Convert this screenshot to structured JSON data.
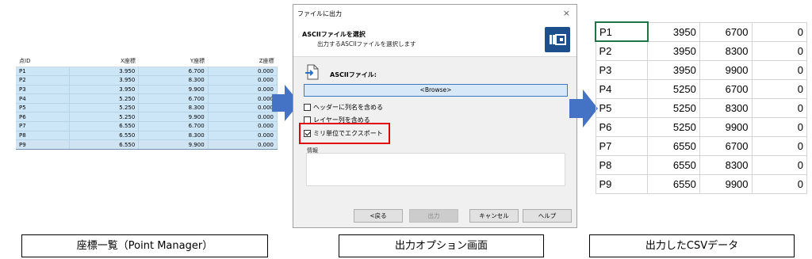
{
  "point_manager": {
    "headers": [
      "点ID",
      "X座標",
      "Y座標",
      "Z座標"
    ],
    "rows": [
      [
        "P1",
        "3.950",
        "6.700",
        "0.000"
      ],
      [
        "P2",
        "3.950",
        "8.300",
        "0.000"
      ],
      [
        "P3",
        "3.950",
        "9.900",
        "0.000"
      ],
      [
        "P4",
        "5.250",
        "6.700",
        "0.000"
      ],
      [
        "P5",
        "5.250",
        "8.300",
        "0.000"
      ],
      [
        "P6",
        "5.250",
        "9.900",
        "0.000"
      ],
      [
        "P7",
        "6.550",
        "6.700",
        "0.000"
      ],
      [
        "P8",
        "6.550",
        "8.300",
        "0.000"
      ],
      [
        "P9",
        "6.550",
        "9.900",
        "0.000"
      ]
    ]
  },
  "dialog": {
    "title": "ファイルに出力",
    "close_glyph": "×",
    "header_title": "ASCIIファイルを選択",
    "header_subtitle": "出力するASCIIファイルを選択します",
    "ascii_label": "ASCIIファイル:",
    "browse_label": "<Browse>",
    "options": [
      {
        "label": "ヘッダーに列名を含める",
        "checked": false
      },
      {
        "label": "レイヤー列を含める",
        "checked": false
      },
      {
        "label": "ミリ単位でエクスポート",
        "checked": true
      }
    ],
    "info_label": "情報",
    "buttons": {
      "back": "<戻る",
      "export": "出力",
      "cancel": "キャンセル",
      "help": "ヘルプ"
    }
  },
  "csv": {
    "rows": [
      [
        "P1",
        "3950",
        "6700",
        "0"
      ],
      [
        "P2",
        "3950",
        "8300",
        "0"
      ],
      [
        "P3",
        "3950",
        "9900",
        "0"
      ],
      [
        "P4",
        "5250",
        "6700",
        "0"
      ],
      [
        "P5",
        "5250",
        "8300",
        "0"
      ],
      [
        "P6",
        "5250",
        "9900",
        "0"
      ],
      [
        "P7",
        "6550",
        "6700",
        "0"
      ],
      [
        "P8",
        "6550",
        "8300",
        "0"
      ],
      [
        "P9",
        "6550",
        "9900",
        "0"
      ]
    ]
  },
  "captions": {
    "left": "座標一覧（Point Manager）",
    "middle": "出力オプション画面",
    "right": "出力したCSVデータ"
  },
  "colors": {
    "arrow": "#4472c4",
    "highlight": "#e00000",
    "row_selected": "#cde6f7",
    "logo": "#1c4f8c"
  }
}
